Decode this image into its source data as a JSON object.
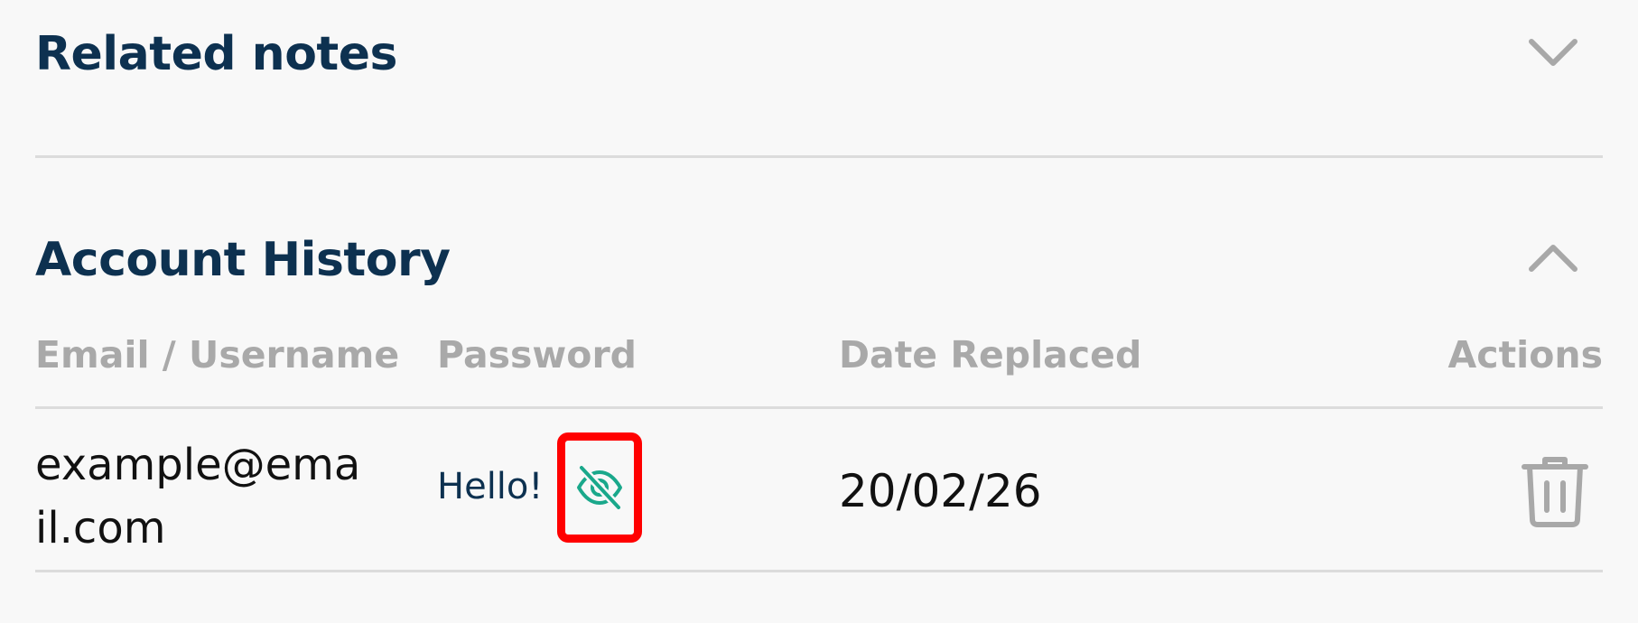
{
  "related_notes": {
    "title": "Related notes",
    "expand_icon": "chevron-down-icon"
  },
  "account_history": {
    "title": "Account History",
    "collapse_icon": "chevron-up-icon",
    "columns": [
      "Email / Username",
      "Password",
      "Date Replaced",
      "Actions"
    ],
    "rows": [
      {
        "email_line1": "example@ema",
        "email_line2": "il.com",
        "password": "Hello!",
        "visibility_icon": "eye-off-icon",
        "date_replaced": "20/02/26",
        "action_icon": "trash-icon"
      }
    ]
  },
  "colors": {
    "title": "#0d3150",
    "header_text": "#a9a9a9",
    "icon_gray": "#a8a8a8",
    "accent_teal": "#1aa88b",
    "highlight_red": "#ff0000",
    "background": "#f8f8f8"
  }
}
